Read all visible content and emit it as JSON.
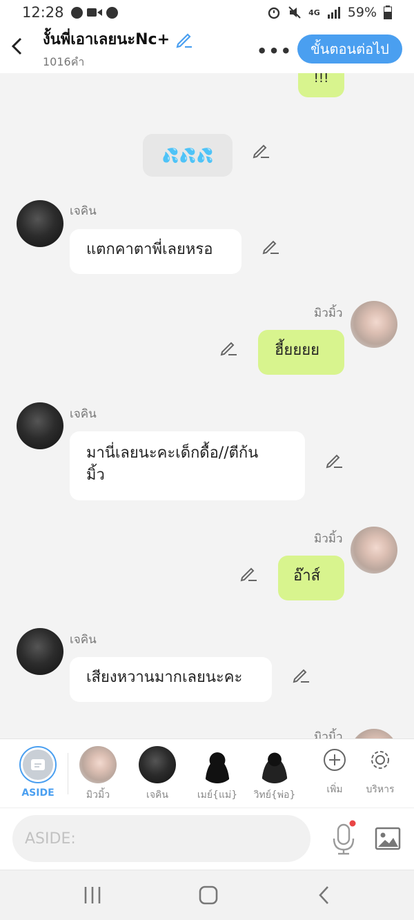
{
  "status": {
    "time": "12:28",
    "battery": "59%",
    "network": "4G"
  },
  "header": {
    "title": "งั้นพี่เอาเลยนะNc+",
    "word_count": "1016คำ",
    "next_label": "ขั้นตอนต่อไป",
    "accent": "#4a9ff0"
  },
  "messages": {
    "top_partial": "!!!",
    "emoji_row": "💦💦💦",
    "m1_name": "เจคิน",
    "m1_text": "แตกคาตาพี่เลยหรอ",
    "m2_name": "มิวมิ้ว",
    "m2_text": "ฮี้ยยยย",
    "m3_name": "เจคิน",
    "m3_text_line1": "มานี่เลยนะคะเด็กดื้อ//ตีก้น",
    "m3_text_line2": "มิ้ว",
    "m4_name": "มิวมิ้ว",
    "m4_text": "อ๊าส์",
    "m5_name": "เจคิน",
    "m5_text": "เสียงหวานมากเลยนะคะ",
    "m6_name_partial": "มิวมิ้ว"
  },
  "bottom_bar": {
    "aside_label": "ASIDE",
    "characters": [
      "มิวมิ้ว",
      "เจคิน",
      "เมย์{แม่}",
      "วิทย์{พ่อ}"
    ],
    "add_label": "เพิ่ม",
    "manage_label": "บริหาร"
  },
  "composer": {
    "placeholder": "ASIDE:"
  },
  "colors": {
    "green_bubble": "#d8f48e",
    "white_bubble": "#ffffff",
    "background": "#f3f3f3"
  }
}
